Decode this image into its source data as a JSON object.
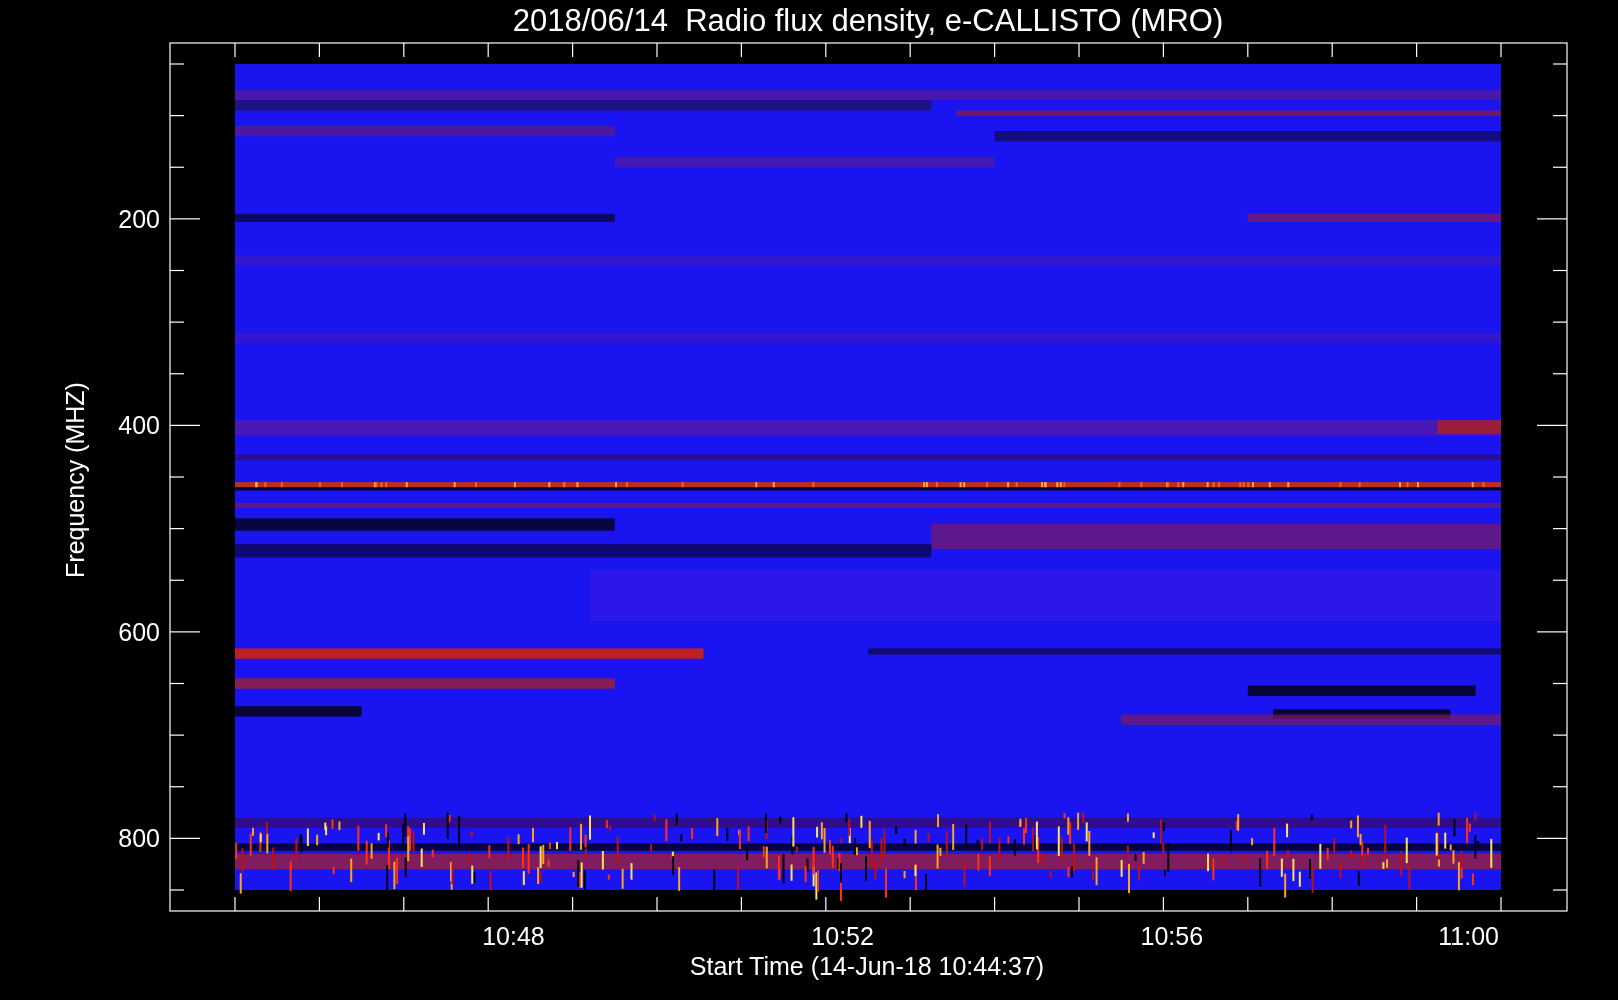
{
  "title": "2018/06/14  Radio flux density, e-CALLISTO (MRO)",
  "y_axis": {
    "label": "Frequency (MHZ)",
    "ticks": [
      "200",
      "400",
      "600",
      "800"
    ]
  },
  "x_axis": {
    "label": "Start Time (14-Jun-18 10:44:37)",
    "ticks": [
      "10:48",
      "10:52",
      "10:56",
      "11:00"
    ]
  }
}
